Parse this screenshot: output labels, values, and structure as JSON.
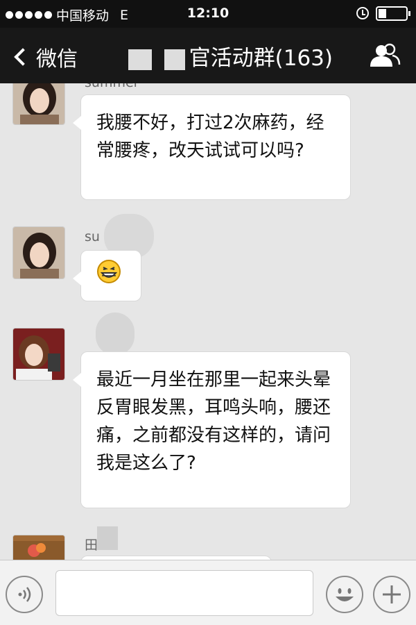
{
  "status_bar": {
    "carrier": "中国移动",
    "network": "E",
    "time": "12:10"
  },
  "nav": {
    "back_label": "微信",
    "title_visible": "官活动群(163)"
  },
  "messages": [
    {
      "sender": "summer",
      "text": "我腰不好，打过2次麻药，经常腰疼，改天试试可以吗?"
    },
    {
      "sender": "su",
      "emoji": "grinning-emoji"
    },
    {
      "sender": "",
      "text": "最近一月坐在那里一起来头晕反胃眼发黑，耳鸣头响，腰还痛，之前都没有这样的，请问我是这么了?"
    },
    {
      "sender": "田",
      "text": ""
    }
  ],
  "input": {
    "value": "",
    "placeholder": ""
  },
  "colors": {
    "header_bg": "#181818",
    "chat_bg": "#e6e6e6",
    "bubble_bg": "#ffffff"
  }
}
